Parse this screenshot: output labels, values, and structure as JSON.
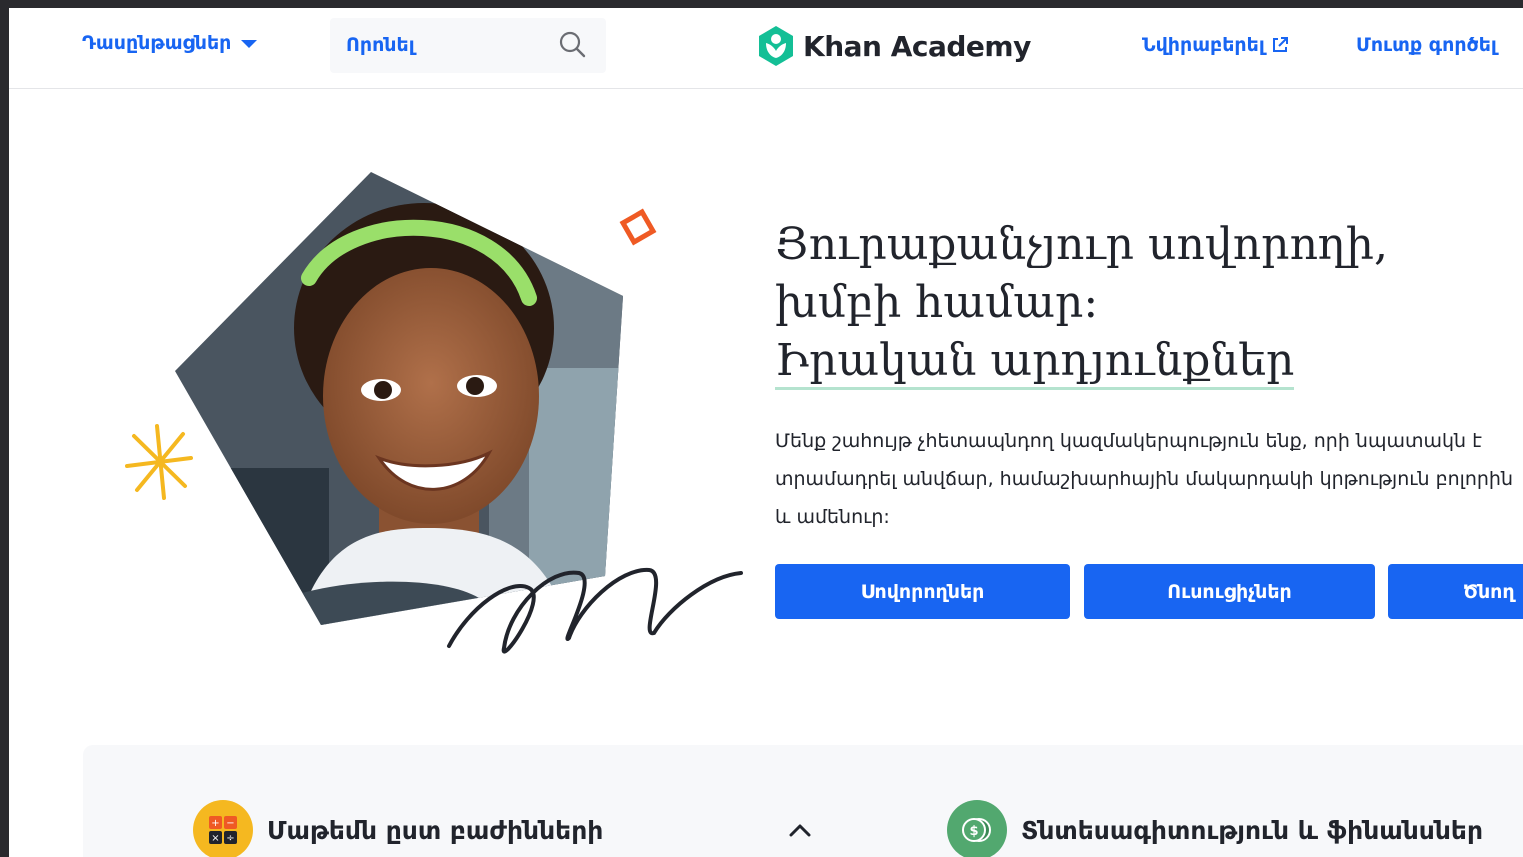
{
  "header": {
    "courses_label": "Դասընթացներ",
    "search_placeholder": "Որոնել",
    "logo_text": "Khan Academy",
    "donate_label": "Նվիրաբերել",
    "login_label": "Մուտք գործել"
  },
  "hero": {
    "headline_line1": "Յուրաքանչյուր սովորողի,",
    "headline_line2": "խմբի համար:",
    "headline_line3": "Իրական արդյունքներ",
    "lead": "Մենք շահույթ չհետապնդող կազմակերպություն ենք, որի նպատակն է տրամադրել անվճար, համաշխարհային մակարդակի կրթություն բոլորին և ամենուր:",
    "buttons": {
      "learners": "Սովորողներ",
      "teachers": "Ուսուցիչներ",
      "parents": "Ծնող"
    }
  },
  "categories": [
    {
      "label": "Մաթեմն ըստ բաժինների",
      "icon": "calculator-icon",
      "color": "#f5b820"
    },
    {
      "label": "Տնտեսագիտություն և ֆինանսներ",
      "icon": "money-icon",
      "color": "#52a86f"
    }
  ],
  "colors": {
    "accent": "#1865f2",
    "text": "#21242c",
    "logo_green": "#14bf96"
  }
}
